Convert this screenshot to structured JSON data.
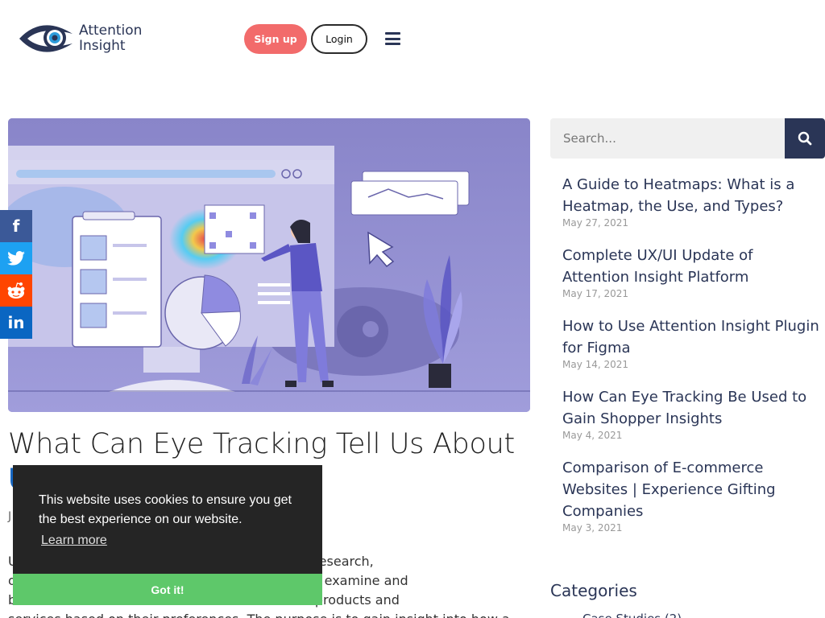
{
  "header": {
    "logo_line1": "Attention",
    "logo_line2": "Insight",
    "signup_label": "Sign up",
    "login_label": "Login",
    "menu_icon": "hamburger-icon"
  },
  "social": [
    {
      "name": "facebook",
      "glyph": "f",
      "color": "#3b5998"
    },
    {
      "name": "twitter",
      "glyph": "t",
      "color": "#1da1f2"
    },
    {
      "name": "reddit",
      "glyph": "r",
      "color": "#ff4500"
    },
    {
      "name": "linkedin",
      "glyph": "in",
      "color": "#0a66c2"
    }
  ],
  "article": {
    "title": "What Can Eye Tracking Tell Us About",
    "title_peek": "U",
    "meta_peek": "J",
    "body": [
      "U                                                ser experience research,",
      "o                                                research aims to examine and",
      "b                                                ation to deliver products and",
      "services based on their preferences. The purpose is to gain insight into how a"
    ]
  },
  "cookie": {
    "message": "This website uses cookies to ensure you get the best experience on our website.",
    "learn_more": "Learn more",
    "accept": "Got it!"
  },
  "sidebar": {
    "search_placeholder": "Search...",
    "posts": [
      {
        "title": "A Guide to Heatmaps: What is a Heatmap, the Use, and Types?",
        "date": "May 27, 2021"
      },
      {
        "title": "Complete UX/UI Update of Attention Insight Platform",
        "date": "May 17, 2021"
      },
      {
        "title": "How to Use Attention Insight Plugin for Figma",
        "date": "May 14, 2021"
      },
      {
        "title": "How Can Eye Tracking Be Used to Gain Shopper Insights",
        "date": "May 4, 2021"
      },
      {
        "title": "Comparison of E-commerce Websites | Experience Gifting Companies",
        "date": "May 3, 2021"
      }
    ],
    "categories_heading": "Categories",
    "categories_peek": "Case Studies (2)"
  },
  "colors": {
    "brand": "#2a3556",
    "signup": "#f26b6b",
    "cookie_accept": "#5ec86a"
  }
}
